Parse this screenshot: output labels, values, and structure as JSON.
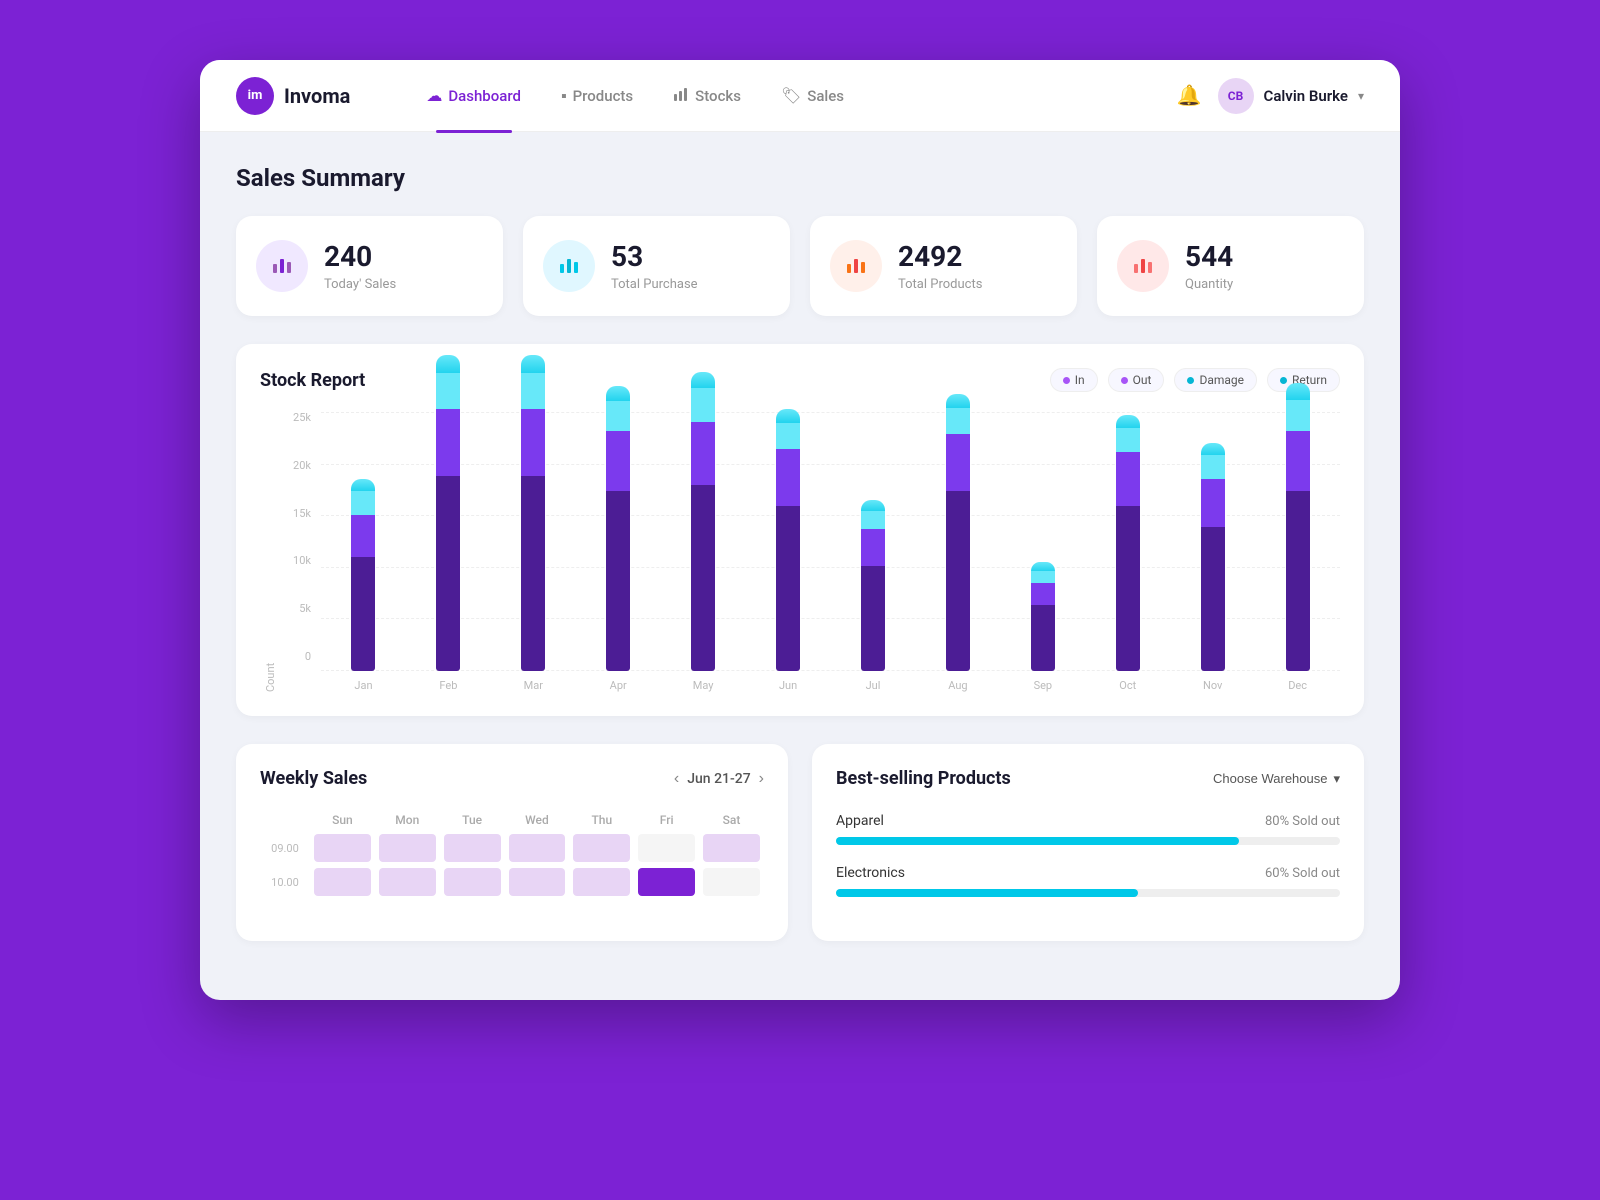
{
  "app": {
    "logo_initials": "im",
    "logo_name": "Invoma"
  },
  "nav": {
    "items": [
      {
        "id": "dashboard",
        "label": "Dashboard",
        "icon": "☁",
        "active": true
      },
      {
        "id": "products",
        "label": "Products",
        "icon": "▪",
        "active": false
      },
      {
        "id": "stocks",
        "label": "Stocks",
        "icon": "📊",
        "active": false
      },
      {
        "id": "sales",
        "label": "Sales",
        "icon": "🏷",
        "active": false
      }
    ],
    "user": {
      "name": "Calvin Burke",
      "initials": "CB"
    }
  },
  "page": {
    "title": "Sales Summary"
  },
  "summary_cards": [
    {
      "id": "today-sales",
      "value": "240",
      "label": "Today' Sales",
      "icon_color": "purple"
    },
    {
      "id": "total-purchase",
      "value": "53",
      "label": "Total Purchase",
      "icon_color": "cyan"
    },
    {
      "id": "total-products",
      "value": "2492",
      "label": "Total Products",
      "icon_color": "orange"
    },
    {
      "id": "quantity",
      "value": "544",
      "label": "Quantity",
      "icon_color": "pink"
    }
  ],
  "stock_report": {
    "title": "Stock Report",
    "legend": [
      {
        "label": "In",
        "color": "#a855f7"
      },
      {
        "label": "Out",
        "color": "#a855f7"
      },
      {
        "label": "Damage",
        "color": "#06b6d4"
      },
      {
        "label": "Return",
        "color": "#06b6d4"
      }
    ],
    "y_labels": [
      "25k",
      "20k",
      "15k",
      "10k",
      "5k",
      "0"
    ],
    "x_labels": [
      "Jan",
      "Feb",
      "Mar",
      "Apr",
      "May",
      "Jun",
      "Jul",
      "Aug",
      "Sep",
      "Oct",
      "Nov",
      "Dec"
    ],
    "y_axis_label": "Count",
    "bars": [
      {
        "month": "Jan",
        "dark": 38,
        "mid": 28,
        "light": 20,
        "cap": 8
      },
      {
        "month": "Feb",
        "dark": 65,
        "mid": 45,
        "light": 30,
        "cap": 12
      },
      {
        "month": "Mar",
        "dark": 65,
        "mid": 45,
        "light": 30,
        "cap": 12
      },
      {
        "month": "Apr",
        "dark": 60,
        "mid": 40,
        "light": 25,
        "cap": 10
      },
      {
        "month": "May",
        "dark": 62,
        "mid": 42,
        "light": 28,
        "cap": 11
      },
      {
        "month": "Jun",
        "dark": 55,
        "mid": 38,
        "light": 22,
        "cap": 9
      },
      {
        "month": "Jul",
        "dark": 35,
        "mid": 25,
        "light": 15,
        "cap": 7
      },
      {
        "month": "Aug",
        "dark": 60,
        "mid": 38,
        "light": 22,
        "cap": 9
      },
      {
        "month": "Sep",
        "dark": 22,
        "mid": 15,
        "light": 10,
        "cap": 6
      },
      {
        "month": "Oct",
        "dark": 55,
        "mid": 36,
        "light": 20,
        "cap": 9
      },
      {
        "month": "Nov",
        "dark": 48,
        "mid": 32,
        "light": 20,
        "cap": 8
      },
      {
        "month": "Dec",
        "dark": 60,
        "mid": 40,
        "light": 26,
        "cap": 11
      }
    ]
  },
  "weekly_sales": {
    "title": "Weekly Sales",
    "week_label": "Jun 21-27",
    "days": [
      "Sun",
      "Mon",
      "Tue",
      "Wed",
      "Thu",
      "Fri",
      "Sat"
    ],
    "times": [
      "09.00",
      "10.00"
    ],
    "rows": [
      [
        1,
        1,
        1,
        1,
        1,
        0,
        1
      ],
      [
        1,
        1,
        1,
        1,
        1,
        2,
        0
      ]
    ]
  },
  "best_selling": {
    "title": "Best-selling Products",
    "warehouse_label": "Choose Warehouse",
    "products": [
      {
        "name": "Apparel",
        "pct": 80,
        "label": "80% Sold out"
      },
      {
        "name": "Electronics",
        "pct": 60,
        "label": "60% Sold out"
      }
    ]
  }
}
